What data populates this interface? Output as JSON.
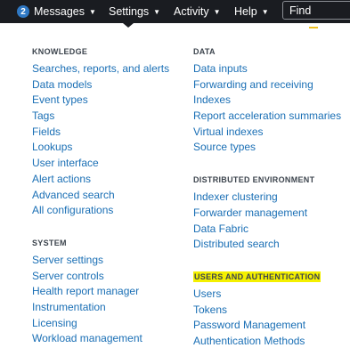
{
  "topbar": {
    "messages": {
      "badge": "2",
      "label": "Messages"
    },
    "settings_label": "Settings",
    "activity_label": "Activity",
    "help_label": "Help",
    "find_placeholder": "Find",
    "caret": "▼"
  },
  "menu": {
    "knowledge": {
      "title": "KNOWLEDGE",
      "items": [
        "Searches, reports, and alerts",
        "Data models",
        "Event types",
        "Tags",
        "Fields",
        "Lookups",
        "User interface",
        "Alert actions",
        "Advanced search",
        "All configurations"
      ]
    },
    "system": {
      "title": "SYSTEM",
      "items": [
        "Server settings",
        "Server controls",
        "Health report manager",
        "Instrumentation",
        "Licensing",
        "Workload management"
      ]
    },
    "data": {
      "title": "DATA",
      "items": [
        "Data inputs",
        "Forwarding and receiving",
        "Indexes",
        "Report acceleration summaries",
        "Virtual indexes",
        "Source types"
      ]
    },
    "distributed": {
      "title": "DISTRIBUTED ENVIRONMENT",
      "items": [
        "Indexer clustering",
        "Forwarder management",
        "Data Fabric",
        "Distributed search"
      ]
    },
    "users_auth": {
      "title": "USERS AND AUTHENTICATION",
      "items": [
        "Users",
        "Tokens",
        "Password Management",
        "Authentication Methods"
      ]
    }
  },
  "colors": {
    "topbar": "#1a1c21",
    "link": "#1a6fb5",
    "section_title": "#3c444d",
    "highlight": "#f4f000",
    "badge": "#2f78c4"
  }
}
